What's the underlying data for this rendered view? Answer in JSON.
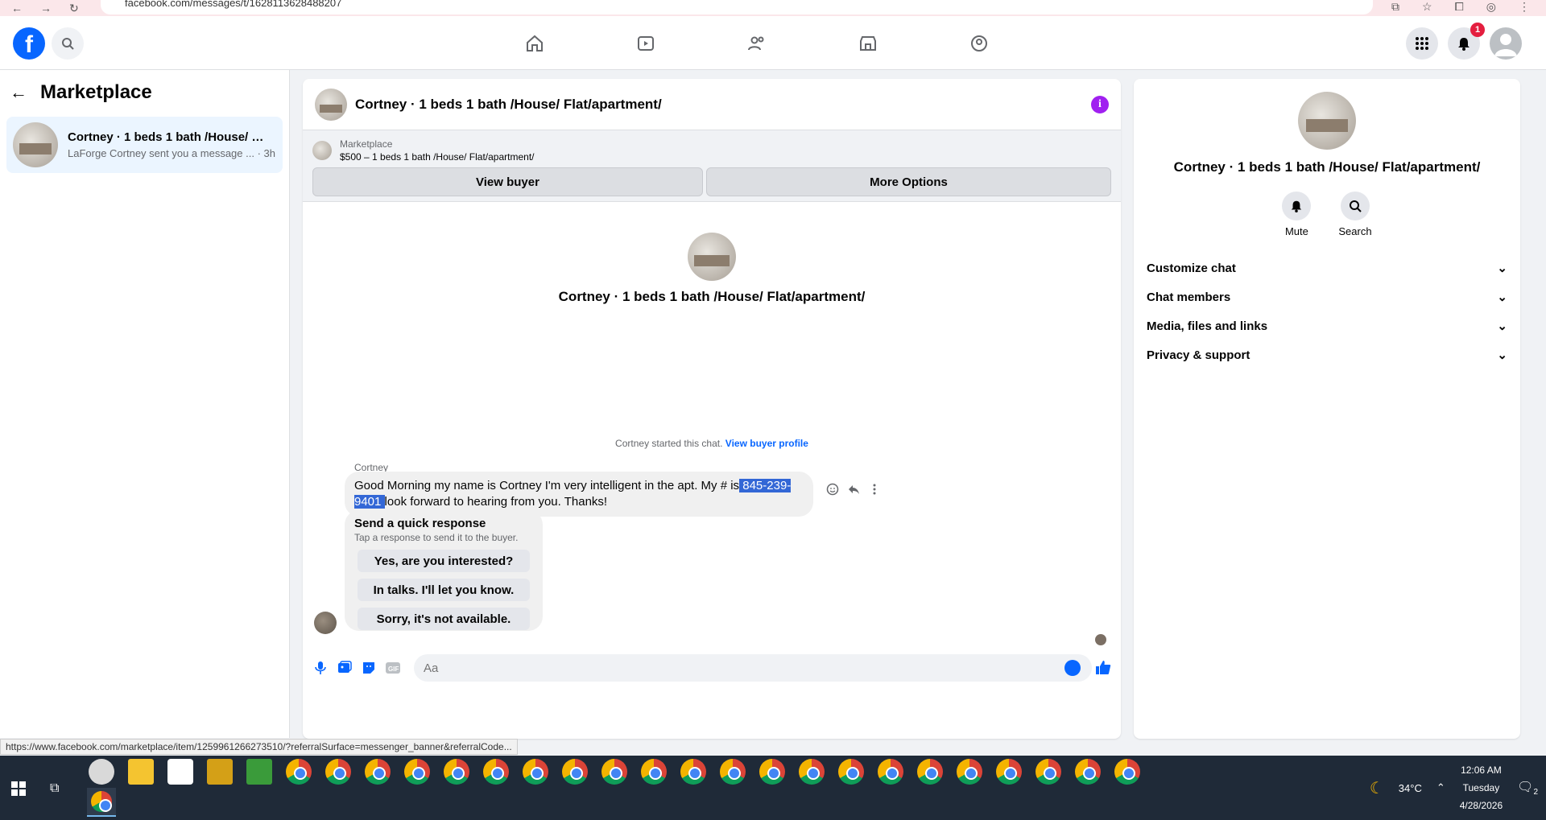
{
  "browser": {
    "url": "facebook.com/messages/t/1628113628488207"
  },
  "topnav": {
    "notification_count": "1"
  },
  "sidebar": {
    "title": "Marketplace",
    "conversation": {
      "title": "Cortney · 1 beds 1 bath /House/ Fl...",
      "subtitle": "LaForge Cortney sent you a message ... · 3h"
    }
  },
  "chat": {
    "title": "Cortney · 1 beds 1 bath /House/ Flat/apartment/",
    "banner": {
      "label": "Marketplace",
      "listing": "$500 – 1 beds 1 bath /House/ Flat/apartment/",
      "view_buyer": "View buyer",
      "more_options": "More Options"
    },
    "intro_title": "Cortney · 1 beds 1 bath /House/ Flat/apartment/",
    "started_text": "Cortney started this chat.",
    "view_profile": "View buyer profile",
    "sender": "Cortney",
    "message_before": "Good Morning my name is Cortney I'm very intelligent in the apt. My # is",
    "message_selected": "845-239-9401",
    "message_after": "look forward to hearing from you. Thanks!",
    "quick": {
      "title": "Send a quick response",
      "subtitle": "Tap a response to send it to the buyer.",
      "options": [
        "Yes, are you interested?",
        "In talks. I'll let you know.",
        "Sorry, it's not available."
      ]
    },
    "composer_placeholder": "Aa"
  },
  "rpanel": {
    "title": "Cortney · 1 beds 1 bath /House/ Flat/apartment/",
    "mute": "Mute",
    "search": "Search",
    "sections": [
      "Customize chat",
      "Chat members",
      "Media, files and links",
      "Privacy & support"
    ]
  },
  "status_link": "https://www.facebook.com/marketplace/item/1259961266273510/?referralSurface=messenger_banner&referralCode...",
  "taskbar": {
    "weather": "34°C",
    "time": "12:06 AM",
    "day": "Tuesday",
    "date": "4/28/2026",
    "notif_count": "2"
  },
  "colors": {
    "fb_blue": "#0866ff",
    "selection": "#3367d6",
    "info_purple": "#a020f0"
  }
}
